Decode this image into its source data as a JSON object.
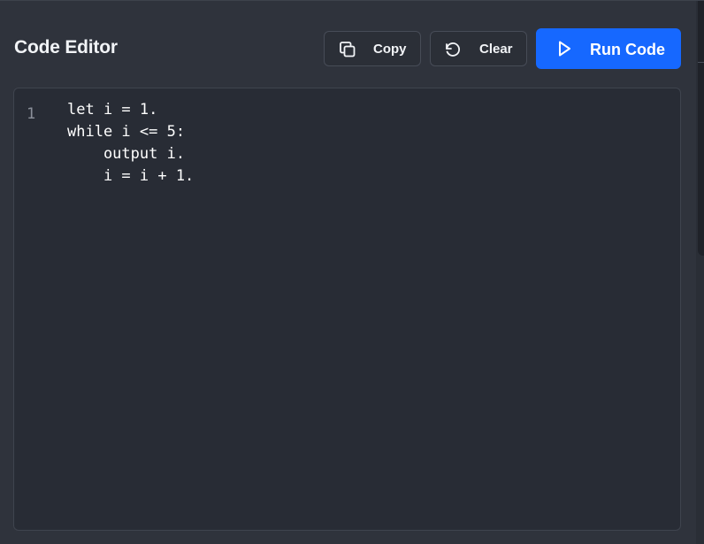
{
  "header": {
    "title": "Code Editor"
  },
  "toolbar": {
    "copy_label": "Copy",
    "clear_label": "Clear",
    "run_label": "Run Code",
    "copy_icon": "copy-icon",
    "clear_icon": "rotate-ccw-icon",
    "run_icon": "play-icon"
  },
  "editor": {
    "line_numbers": [
      "1"
    ],
    "code": "let i = 1.\nwhile i <= 5:\n    output i.\n    i = i + 1."
  },
  "colors": {
    "background": "#2f333c",
    "editor_background": "#282c35",
    "accent": "#1668ff",
    "text": "#f2f4f7"
  }
}
